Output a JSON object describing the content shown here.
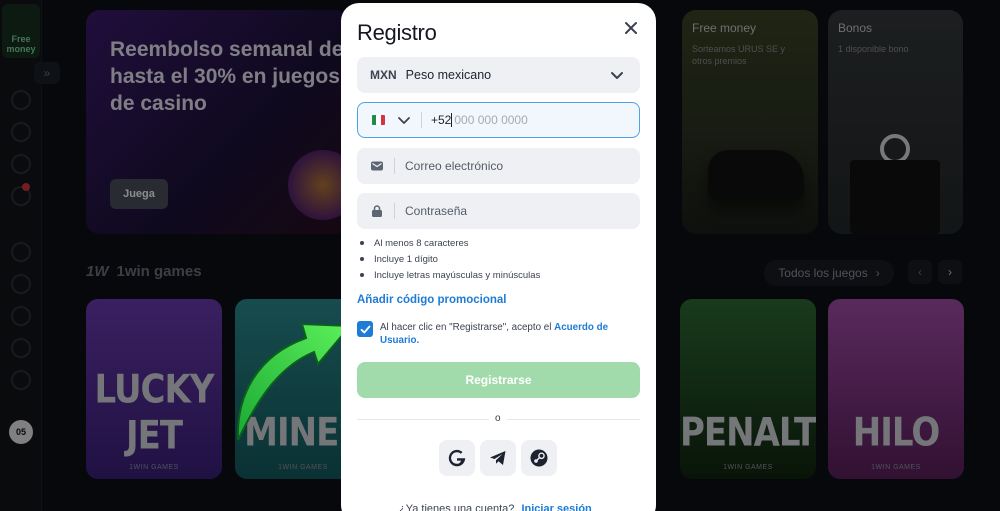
{
  "sidebar": {
    "free_money": "Free money",
    "lang": "05",
    "expand_icon": "double-chevron-right-icon"
  },
  "background": {
    "promo": {
      "title": "Reembolso semanal de hasta el 30% en juegos de casino",
      "button": "Juega"
    },
    "cards": {
      "free_money_title": "Free money",
      "free_money_sub": "Sorteamos URUS SE y otros premios",
      "bonos_title": "Bonos",
      "bonos_sub": "1 disponible bono"
    },
    "games": {
      "logo": "1W",
      "title": "1win games",
      "all_games": "Todos los juegos",
      "list": [
        {
          "name": "LUCKY JET",
          "brand": "1WIN GAMES",
          "color": "#4a2a8a"
        },
        {
          "name": "MINES",
          "brand": "1WIN GAMES",
          "color": "#1f6e74"
        },
        {
          "name": "PENALTY",
          "brand": "1WIN GAMES",
          "color": "#1f3f22"
        },
        {
          "name": "HILO",
          "brand": "1WIN GAMES",
          "color": "#6a2a6e"
        }
      ]
    }
  },
  "modal": {
    "title": "Registro",
    "close_icon": "close-icon",
    "currency": {
      "code": "MXN",
      "name": "Peso mexicano"
    },
    "phone": {
      "country": "MX",
      "code": "+52",
      "placeholder": "000 000 0000"
    },
    "email": {
      "placeholder": "Correo electrónico"
    },
    "password": {
      "placeholder": "Contraseña"
    },
    "rules": [
      "Al menos 8 caracteres",
      "Incluye 1 dígito",
      "Incluye letras mayúsculas y minúsculas"
    ],
    "promo_link": "Añadir código promocional",
    "consent": {
      "checked": true,
      "text": "Al hacer clic en \"Registrarse\", acepto el",
      "link": "Acuerdo de Usuario."
    },
    "register_button": "Registrarse",
    "divider": "o",
    "social": [
      "google-icon",
      "telegram-icon",
      "steam-icon"
    ],
    "login": {
      "text": "¿Ya tienes una cuenta?",
      "link": "Iniciar sesión"
    }
  },
  "colors": {
    "accent_blue": "#1e7bd6",
    "register_green": "#a2dbab",
    "arrow_green": "#2fd14a"
  }
}
